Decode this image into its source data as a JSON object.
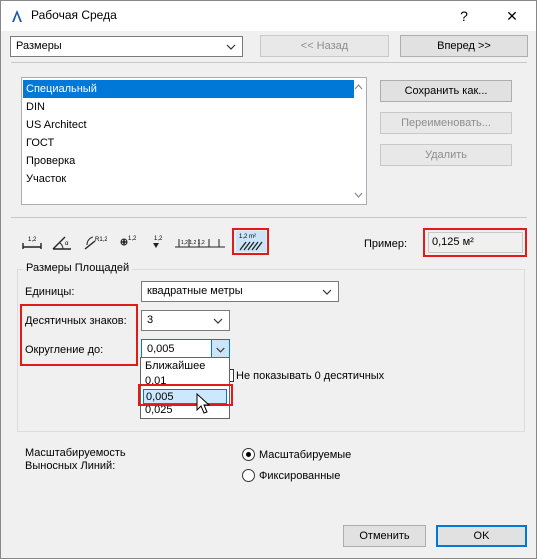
{
  "window": {
    "title": "Рабочая Среда",
    "help": "?",
    "close": "✕"
  },
  "top": {
    "scheme_value": "Размеры",
    "back_label": "<< Назад",
    "forward_label": "Вперед >>"
  },
  "schemes": {
    "items": [
      "Специальный",
      "DIN",
      "US Architect",
      "ГОСТ",
      "Проверка",
      "Участок"
    ],
    "selected_index": 0
  },
  "side_buttons": {
    "save_as": "Сохранить как...",
    "rename": "Переименовать...",
    "delete": "Удалить"
  },
  "toolbar": {
    "icons": [
      "linear-dimension-icon",
      "angle-dimension-icon",
      "radial-dimension-icon",
      "level-dimension-icon",
      "elevation-dimension-icon",
      "door-window-dimension-icon",
      "area-dimension-icon"
    ],
    "area_icon_text": "1,2 m²"
  },
  "example": {
    "label": "Пример:",
    "value": "0,125 м²"
  },
  "area_group": {
    "title": "Размеры Площадей",
    "units_label": "Единицы:",
    "units_value": "квадратные метры",
    "decimals_label": "Десятичных знаков:",
    "decimals_value": "3",
    "rounding_label": "Округление до:",
    "rounding_value": "0,005",
    "rounding_options": [
      "Ближайшее",
      "0,01",
      "0,005",
      "0,025"
    ],
    "rounding_highlighted": 2,
    "hide_zero_label": "Не показывать 0 десятичных"
  },
  "scaling": {
    "label_line1": "Масштабируемость",
    "label_line2": "Выносных Линий:",
    "option_scaled": "Масштабируемые",
    "option_fixed": "Фиксированные",
    "selected": "scaled"
  },
  "footer": {
    "cancel": "Отменить",
    "ok": "OK"
  },
  "colors": {
    "accent": "#0078d7",
    "highlight": "#e31a1a"
  }
}
